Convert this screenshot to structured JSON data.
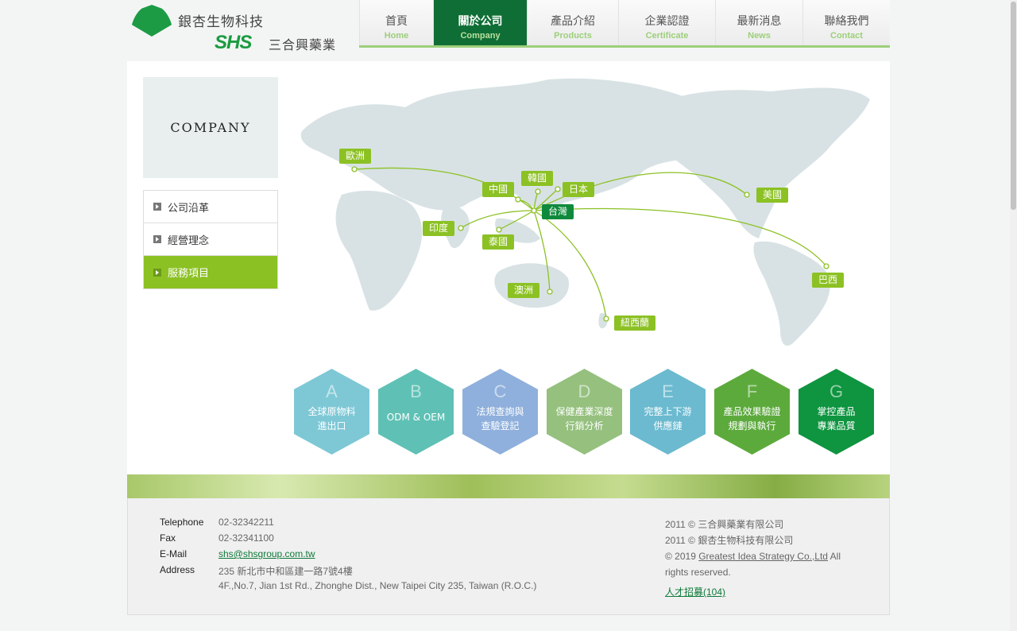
{
  "brand": {
    "name_gingko": "銀杏生物科技",
    "name_shs_logo": "SHS",
    "name_shs": "三合興藥業"
  },
  "nav": [
    {
      "zh": "首頁",
      "en": "Home"
    },
    {
      "zh": "關於公司",
      "en": "Company"
    },
    {
      "zh": "產品介紹",
      "en": "Products"
    },
    {
      "zh": "企業認證",
      "en": "Certificate"
    },
    {
      "zh": "最新消息",
      "en": "News"
    },
    {
      "zh": "聯絡我們",
      "en": "Contact"
    }
  ],
  "sidebar": {
    "title": "COMPANY",
    "items": [
      {
        "label": "公司沿革"
      },
      {
        "label": "經營理念"
      },
      {
        "label": "服務項目"
      }
    ]
  },
  "map": {
    "labels": {
      "europe": "歐洲",
      "china": "中國",
      "korea": "韓國",
      "japan": "日本",
      "taiwan": "台灣",
      "india": "印度",
      "thailand": "泰國",
      "australia": "澳洲",
      "newzealand": "紐西蘭",
      "usa": "美國",
      "brazil": "巴西"
    }
  },
  "services": [
    {
      "letter": "A",
      "line1": "全球原物料",
      "line2": "進出口",
      "color": "#7ec8d6"
    },
    {
      "letter": "B",
      "line1": "ODM & OEM",
      "line2": "",
      "color": "#5fc1b5"
    },
    {
      "letter": "C",
      "line1": "法規查詢與",
      "line2": "查驗登記",
      "color": "#8fb0dc"
    },
    {
      "letter": "D",
      "line1": "保健產業深度",
      "line2": "行銷分析",
      "color": "#95c07e"
    },
    {
      "letter": "E",
      "line1": "完整上下游",
      "line2": "供應鏈",
      "color": "#6bbad0"
    },
    {
      "letter": "F",
      "line1": "產品效果驗證",
      "line2": "規劃與執行",
      "color": "#5caa3c"
    },
    {
      "letter": "G",
      "line1": "掌控產品",
      "line2": "專業品質",
      "color": "#0f9440"
    }
  ],
  "footer": {
    "telephone_label": "Telephone",
    "telephone": "02-32342211",
    "fax_label": "Fax",
    "fax": "02-32341100",
    "email_label": "E-Mail",
    "email": "shs@shsgroup.com.tw",
    "address_label": "Address",
    "address_zh": "235 新北市中和區建一路7號4樓",
    "address_en": "4F.,No.7, Jian 1st Rd., Zhonghe Dist., New Taipei City 235, Taiwan (R.O.C.)",
    "copy1": "2011 © 三合興藥業有限公司",
    "copy2": "2011 © 銀杏生物科技有限公司",
    "copy3_prefix": "© 2019",
    "copy3_link": "Greatest Idea Strategy Co.,Ltd",
    "copy3_suffix": "All rights reserved.",
    "recruit": "人才招募(104)"
  }
}
